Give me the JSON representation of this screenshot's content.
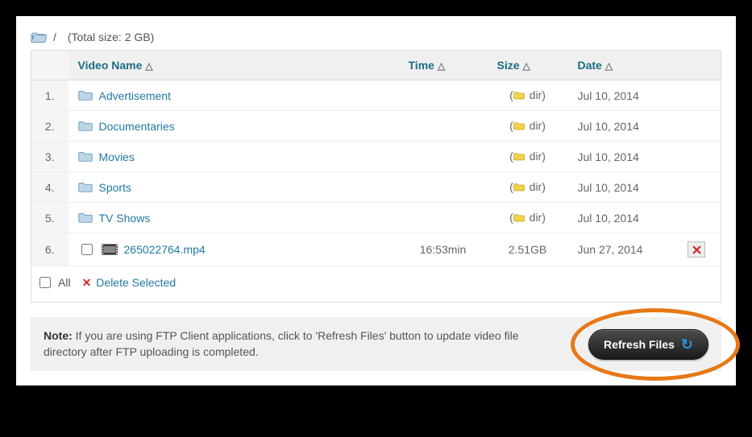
{
  "breadcrumb": {
    "path": "/",
    "total_size_label": "(Total size: 2 GB)"
  },
  "columns": {
    "num": "",
    "name": "Video Name",
    "time": "Time",
    "size": "Size",
    "date": "Date",
    "act": ""
  },
  "rows": [
    {
      "num": "1.",
      "type": "dir",
      "name": "Advertisement",
      "time": "",
      "size": "dir",
      "date": "Jul 10, 2014"
    },
    {
      "num": "2.",
      "type": "dir",
      "name": "Documentaries",
      "time": "",
      "size": "dir",
      "date": "Jul 10, 2014"
    },
    {
      "num": "3.",
      "type": "dir",
      "name": "Movies",
      "time": "",
      "size": "dir",
      "date": "Jul 10, 2014"
    },
    {
      "num": "4.",
      "type": "dir",
      "name": "Sports",
      "time": "",
      "size": "dir",
      "date": "Jul 10, 2014"
    },
    {
      "num": "5.",
      "type": "dir",
      "name": "TV Shows",
      "time": "",
      "size": "dir",
      "date": "Jul 10, 2014"
    },
    {
      "num": "6.",
      "type": "file",
      "name": "265022764.mp4",
      "time": "16:53min",
      "size": "2.51GB",
      "date": "Jun 27, 2014"
    }
  ],
  "footer": {
    "all_label": "All",
    "delete_selected_label": "Delete Selected"
  },
  "note": {
    "prefix": "Note:",
    "text": "If you are using FTP Client applications, click to 'Refresh Files' button to update video file directory after FTP uploading is completed."
  },
  "refresh_button_label": "Refresh Files"
}
